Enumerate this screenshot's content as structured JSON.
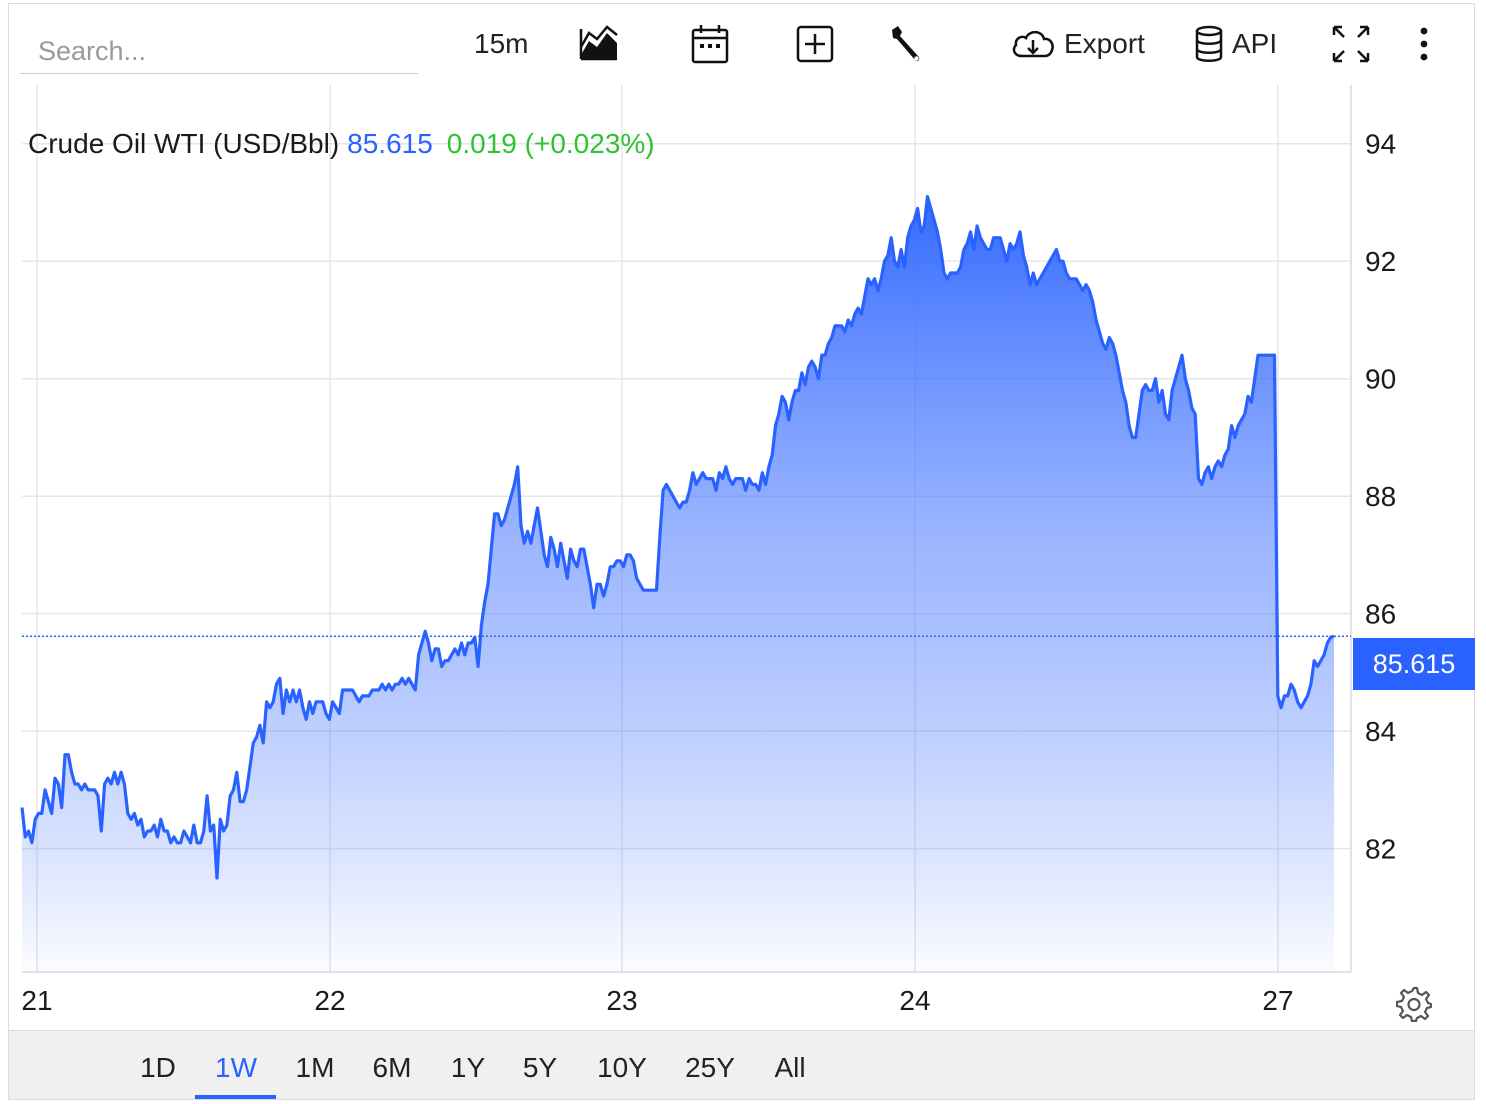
{
  "toolbar": {
    "search_placeholder": "Search...",
    "interval_label": "15m",
    "export_label": "Export",
    "api_label": "API"
  },
  "header": {
    "instrument": "Crude Oil WTI (USD/Bbl)",
    "price": "85.615",
    "change": "0.019 (+0.023%)"
  },
  "price_tag": "85.615",
  "ranges": [
    "1D",
    "1W",
    "1M",
    "6M",
    "1Y",
    "5Y",
    "10Y",
    "25Y",
    "All"
  ],
  "active_range": "1W",
  "colors": {
    "accent": "#2962ff",
    "positive": "#2ec332",
    "grid": "#e6e6e6"
  },
  "icons": [
    "chart-type-icon",
    "calendar-icon",
    "add-icon",
    "wrench-icon",
    "cloud-download-icon",
    "database-icon",
    "fullscreen-icon",
    "more-vertical-icon",
    "gear-icon"
  ],
  "chart_data": {
    "type": "area",
    "x_ticks": [
      "21",
      "22",
      "23",
      "24",
      "27"
    ],
    "y_ticks": [
      "82",
      "84",
      "86",
      "88",
      "90",
      "92",
      "94"
    ],
    "ylim": [
      79.9,
      95
    ],
    "last_value": 85.615,
    "grid": true,
    "series": [
      {
        "values": [
          82.7,
          82.2,
          82.3,
          82.1,
          82.5,
          82.6,
          82.6,
          83.0,
          82.8,
          82.6,
          83.2,
          83.1,
          82.7,
          83.6,
          83.6,
          83.3,
          83.1,
          83.1,
          83.0,
          83.1,
          83.0,
          83.0,
          83.0,
          82.9,
          82.3,
          83.1,
          83.2,
          83.1,
          83.3,
          83.1,
          83.3,
          83.1,
          82.6,
          82.5,
          82.6,
          82.4,
          82.5,
          82.2,
          82.3,
          82.3,
          82.4,
          82.2,
          82.5,
          82.3,
          82.3,
          82.1,
          82.2,
          82.1,
          82.1,
          82.3,
          82.2,
          82.1,
          82.4,
          82.1,
          82.1,
          82.3,
          82.9,
          82.3,
          82.4,
          81.5,
          82.5,
          82.3,
          82.4,
          82.9,
          83.0,
          83.3,
          82.8,
          82.8,
          83.0,
          83.4,
          83.8,
          83.9,
          84.1,
          83.8,
          84.5,
          84.4,
          84.5,
          84.8,
          84.9,
          84.3,
          84.7,
          84.5,
          84.7,
          84.5,
          84.7,
          84.4,
          84.2,
          84.5,
          84.3,
          84.5,
          84.5,
          84.5,
          84.3,
          84.2,
          84.5,
          84.4,
          84.3,
          84.7,
          84.7,
          84.7,
          84.7,
          84.6,
          84.5,
          84.6,
          84.6,
          84.6,
          84.7,
          84.7,
          84.7,
          84.8,
          84.7,
          84.8,
          84.7,
          84.8,
          84.8,
          84.9,
          84.8,
          84.9,
          84.8,
          84.7,
          85.3,
          85.5,
          85.7,
          85.5,
          85.2,
          85.4,
          85.4,
          85.1,
          85.2,
          85.2,
          85.3,
          85.4,
          85.3,
          85.5,
          85.3,
          85.5,
          85.5,
          85.6,
          85.1,
          85.8,
          86.2,
          86.5,
          87.1,
          87.7,
          87.7,
          87.5,
          87.6,
          87.8,
          88.0,
          88.2,
          88.5,
          87.5,
          87.2,
          87.4,
          87.2,
          87.5,
          87.8,
          87.4,
          87.0,
          86.8,
          87.3,
          87.1,
          86.8,
          87.2,
          86.9,
          86.6,
          87.1,
          86.9,
          86.8,
          87.1,
          87.1,
          86.8,
          86.5,
          86.1,
          86.5,
          86.5,
          86.3,
          86.5,
          86.8,
          86.8,
          86.9,
          86.9,
          86.8,
          87.0,
          87.0,
          86.9,
          86.6,
          86.5,
          86.4,
          86.4,
          86.4,
          86.4,
          86.4,
          87.3,
          88.1,
          88.2,
          88.1,
          88.0,
          87.9,
          87.8,
          87.9,
          87.9,
          88.1,
          88.4,
          88.2,
          88.3,
          88.4,
          88.3,
          88.3,
          88.3,
          88.1,
          88.4,
          88.3,
          88.5,
          88.3,
          88.2,
          88.3,
          88.3,
          88.3,
          88.1,
          88.3,
          88.2,
          88.2,
          88.1,
          88.4,
          88.2,
          88.5,
          88.7,
          89.2,
          89.4,
          89.7,
          89.6,
          89.3,
          89.6,
          89.8,
          89.8,
          90.1,
          89.9,
          90.2,
          90.3,
          90.2,
          90.0,
          90.4,
          90.4,
          90.6,
          90.7,
          90.9,
          90.9,
          90.9,
          90.8,
          91.0,
          90.9,
          91.1,
          91.2,
          91.1,
          91.4,
          91.7,
          91.6,
          91.7,
          91.5,
          91.7,
          92.0,
          92.1,
          92.4,
          92.0,
          91.9,
          92.2,
          91.9,
          92.4,
          92.6,
          92.7,
          92.9,
          92.5,
          92.6,
          93.1,
          92.9,
          92.7,
          92.5,
          92.2,
          91.8,
          91.7,
          91.8,
          91.8,
          91.8,
          91.9,
          92.2,
          92.3,
          92.5,
          92.2,
          92.6,
          92.4,
          92.3,
          92.2,
          92.2,
          92.4,
          92.4,
          92.4,
          92.2,
          92.0,
          92.3,
          92.2,
          92.3,
          92.5,
          92.1,
          91.9,
          91.6,
          91.8,
          91.6,
          91.7,
          91.8,
          91.9,
          92.0,
          92.1,
          92.2,
          92.0,
          92.0,
          91.8,
          91.7,
          91.7,
          91.7,
          91.6,
          91.5,
          91.6,
          91.5,
          91.3,
          91.0,
          90.8,
          90.6,
          90.5,
          90.7,
          90.6,
          90.4,
          90.1,
          89.8,
          89.6,
          89.2,
          89.0,
          89.0,
          89.4,
          89.8,
          89.9,
          89.8,
          89.8,
          90.0,
          89.6,
          89.8,
          89.4,
          89.3,
          89.8,
          90.0,
          90.2,
          90.4,
          90.0,
          89.8,
          89.5,
          89.4,
          88.3,
          88.2,
          88.4,
          88.5,
          88.3,
          88.5,
          88.6,
          88.5,
          88.7,
          88.8,
          89.2,
          89.0,
          89.2,
          89.3,
          89.4,
          89.7,
          89.6,
          90.0,
          90.4,
          90.4,
          90.4,
          90.4,
          90.4,
          90.4,
          84.6,
          84.4,
          84.6,
          84.6,
          84.8,
          84.7,
          84.5,
          84.4,
          84.5,
          84.6,
          84.8,
          85.2,
          85.1,
          85.2,
          85.3,
          85.5,
          85.6,
          85.615
        ]
      }
    ]
  }
}
